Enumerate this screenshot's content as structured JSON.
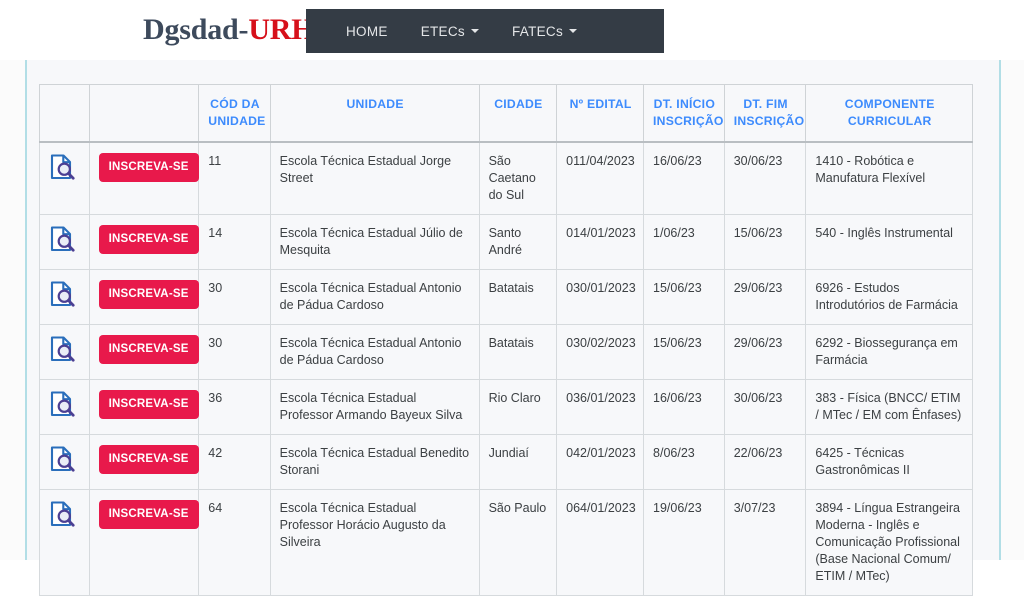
{
  "header": {
    "brand_primary": "Dgsdad-",
    "brand_accent": "URH",
    "nav": [
      {
        "label": "HOME",
        "has_caret": false
      },
      {
        "label": "ETECs",
        "has_caret": true
      },
      {
        "label": "FATECs",
        "has_caret": true
      }
    ]
  },
  "colors": {
    "navbar_bg": "#343c45",
    "brand_primary": "#3d4a5c",
    "brand_accent": "#d6101a",
    "button_bg": "#e8194b",
    "header_text": "#3d8bfd",
    "page_bg": "#f7f8fa",
    "edge_line": "#b2dee6",
    "icon_blue": "#2a6ebb",
    "icon_purple": "#4b3f93"
  },
  "table": {
    "icon_name": "document-search-icon",
    "action_label": "INSCREVA-SE",
    "columns": [
      "",
      "",
      "CÓD DA UNIDADE",
      "UNIDADE",
      "CIDADE",
      "Nº EDITAL",
      "DT. INÍCIO INSCRIÇÃO",
      "DT. FIM INSCRIÇÃO",
      "COMPONENTE CURRICULAR"
    ],
    "rows": [
      {
        "cod": "11",
        "unidade": "Escola Técnica Estadual Jorge Street",
        "cidade": "São Caetano do Sul",
        "edital": "011/04/2023",
        "inicio": "16/06/23",
        "fim": "30/06/23",
        "componente": "1410 - Robótica e Manufatura Flexível"
      },
      {
        "cod": "14",
        "unidade": "Escola Técnica Estadual Júlio de Mesquita",
        "cidade": "Santo André",
        "edital": "014/01/2023",
        "inicio": "1/06/23",
        "fim": "15/06/23",
        "componente": "540 - Inglês Instrumental"
      },
      {
        "cod": "30",
        "unidade": "Escola Técnica Estadual Antonio de Pádua Cardoso",
        "cidade": "Batatais",
        "edital": "030/01/2023",
        "inicio": "15/06/23",
        "fim": "29/06/23",
        "componente": "6926 - Estudos Introdutórios de Farmácia"
      },
      {
        "cod": "30",
        "unidade": "Escola Técnica Estadual Antonio de Pádua Cardoso",
        "cidade": "Batatais",
        "edital": "030/02/2023",
        "inicio": "15/06/23",
        "fim": "29/06/23",
        "componente": "6292 - Biossegurança em Farmácia"
      },
      {
        "cod": "36",
        "unidade": "Escola Técnica Estadual Professor Armando Bayeux Silva",
        "cidade": "Rio Claro",
        "edital": "036/01/2023",
        "inicio": "16/06/23",
        "fim": "30/06/23",
        "componente": "383 - Física (BNCC/ ETIM / MTec / EM com Ênfases)"
      },
      {
        "cod": "42",
        "unidade": "Escola Técnica Estadual Benedito Storani",
        "cidade": "Jundiaí",
        "edital": "042/01/2023",
        "inicio": "8/06/23",
        "fim": "22/06/23",
        "componente": "6425 - Técnicas Gastronômicas II"
      },
      {
        "cod": "64",
        "unidade": "Escola Técnica Estadual Professor Horácio Augusto da Silveira",
        "cidade": "São Paulo",
        "edital": "064/01/2023",
        "inicio": "19/06/23",
        "fim": "3/07/23",
        "componente": "3894 - Língua Estrangeira Moderna - Inglês e Comunicação Profissional (Base Nacional Comum/ ETIM / MTec)"
      }
    ]
  }
}
